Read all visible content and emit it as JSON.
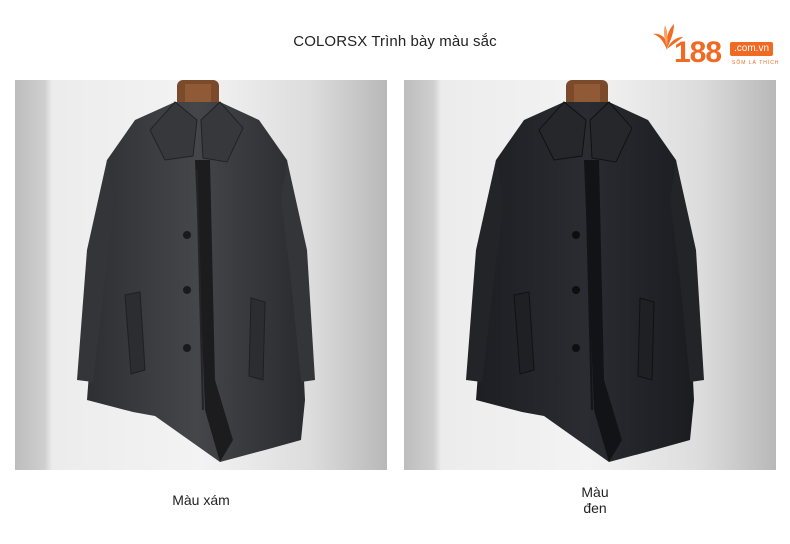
{
  "header": {
    "title": "COLORSX Trình bày màu sắc"
  },
  "logo": {
    "number": "188",
    "domain": ".com.vn",
    "tagline": "SỐM LÀ THÍCH",
    "brand_color": "#f06a24"
  },
  "swatches": [
    {
      "label": "Màu xám",
      "coat_color": "#3a3b3e"
    },
    {
      "label_line1": "Màu",
      "label_line2": "đen",
      "coat_color": "#222428"
    }
  ]
}
